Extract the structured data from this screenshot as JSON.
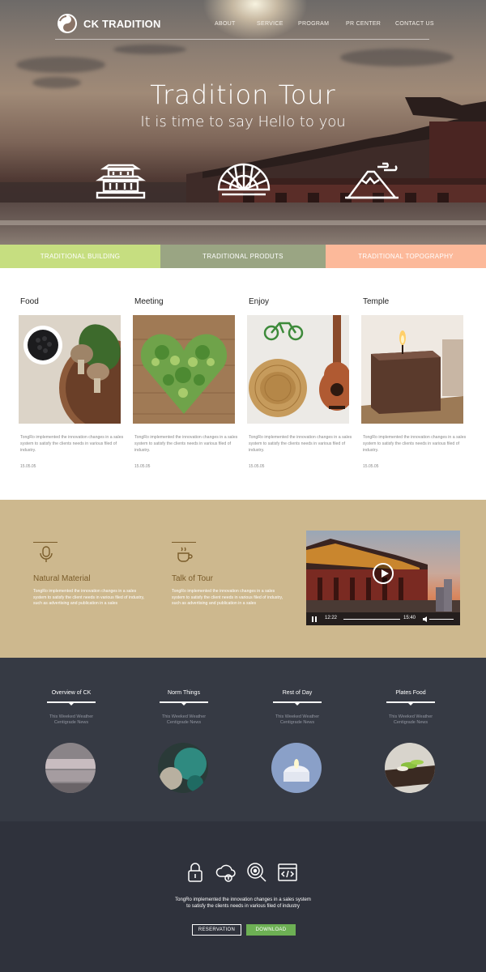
{
  "brand": {
    "name": "CK TRADITION"
  },
  "nav": [
    {
      "label": "ABOUT"
    },
    {
      "label": "SERVICE"
    },
    {
      "label": "PROGRAM"
    },
    {
      "label": "PR CENTER"
    },
    {
      "label": "CONTACT US"
    }
  ],
  "hero": {
    "title": "Tradition Tour",
    "subtitle": "It is time to say Hello to  you",
    "icons": [
      "building-icon",
      "fan-icon",
      "mountain-icon"
    ]
  },
  "tabs": [
    {
      "label": "TRADITIONAL BUILDING",
      "color": "#c6de80"
    },
    {
      "label": "TRADITIONAL PRODUTS",
      "color": "#9aa583"
    },
    {
      "label": "TRADITIONAL TOPOGRAPHY",
      "color": "#fcb99a"
    }
  ],
  "cards": [
    {
      "title": "Food",
      "desc": "TongRo implemented the innovation changes in a sales system to satisfy the clients needs in various filed of industry.",
      "date": "15.05.05"
    },
    {
      "title": "Meeting",
      "desc": "TongRo implemented the innovation changes in a sales system to satisfy the clients needs in various filed of industry.",
      "date": "15.05.05"
    },
    {
      "title": "Enjoy",
      "desc": "TongRo implemented the innovation changes in a sales system to satisfy the clients needs in various filed of industry.",
      "date": "15.05.05"
    },
    {
      "title": "Temple",
      "desc": "TongRo implemented the innovation changes in a sales system to satisfy the clients needs in various filed of industry.",
      "date": "15.05.05"
    }
  ],
  "features": [
    {
      "title": "Natural Material",
      "desc": "TongRo implemented the innovation changes in a sales system to satisfy the client needs in various filed of industry, such as advertising and publication in a sales",
      "icon": "microphone-icon"
    },
    {
      "title": "Talk of Tour",
      "desc": "TongRo implemented the innovation changes in a sales system to satisfy the client needs in various filed of industry, such as advertising and publication in a sales",
      "icon": "coffee-cup-icon"
    }
  ],
  "video": {
    "current_time": "12:22",
    "duration": "15:40",
    "progress": 0.35
  },
  "items": [
    {
      "title": "Overview of CK",
      "sub1": "This Weeked Weather",
      "sub2": "Centigrade News"
    },
    {
      "title": "Norm Things",
      "sub1": "This Weeked Weather",
      "sub2": "Centigrade News"
    },
    {
      "title": "Rest of Day",
      "sub1": "This Weeked Weather",
      "sub2": "Centigrade News"
    },
    {
      "title": "Plates Food",
      "sub1": "This Weeked Weather",
      "sub2": "Centigrade News"
    }
  ],
  "footer": {
    "line1": "TongRo implemented the innovation changes in a sales system",
    "line2": "to satisfy the clients needs in various filed of industry",
    "reservation": "RESERVATION",
    "download": "DOWNLOAD",
    "icons": [
      "lock-icon",
      "cloud-upload-icon",
      "search-target-icon",
      "code-window-icon"
    ],
    "accent": "#6db054"
  }
}
